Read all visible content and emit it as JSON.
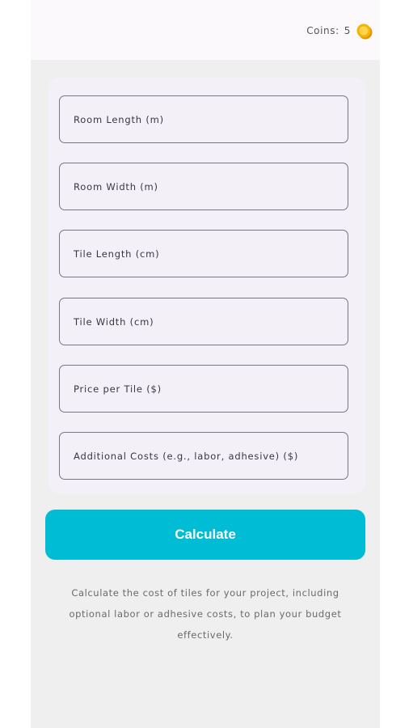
{
  "header": {
    "coins_label": "Coins:",
    "coins_value": "5",
    "coin_icon": "coin-icon",
    "coin_color": "#f4b400"
  },
  "form": {
    "fields": [
      {
        "placeholder": "Room Length (m)",
        "value": ""
      },
      {
        "placeholder": "Room Width (m)",
        "value": ""
      },
      {
        "placeholder": "Tile Length (cm)",
        "value": ""
      },
      {
        "placeholder": "Tile Width (cm)",
        "value": ""
      },
      {
        "placeholder": "Price per Tile ($)",
        "value": ""
      },
      {
        "placeholder": "Additional Costs (e.g., labor, adhesive) ($)",
        "value": ""
      }
    ]
  },
  "actions": {
    "calculate_label": "Calculate",
    "accent_color": "#00bcd4"
  },
  "description": "Calculate the cost of tiles for your project, including optional labor or adhesive costs, to plan your budget effectively."
}
